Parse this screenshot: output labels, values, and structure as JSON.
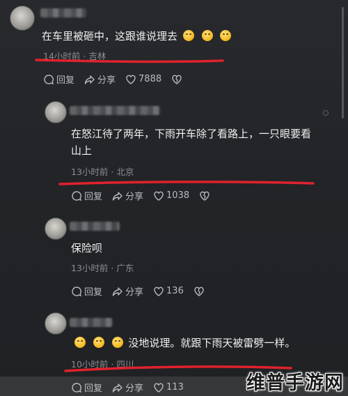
{
  "colors": {
    "accent_red": "#e0222c",
    "background": "#242629",
    "meta_text": "#8b8d92"
  },
  "comments": [
    {
      "text_parts": [
        "在车里被砸中，这跟谁说理去",
        "",
        "",
        ""
      ],
      "emoji_count": 3,
      "time": "14小时前",
      "location": "吉林",
      "reply_label": "回复",
      "share_label": "分享",
      "like_count": "7888"
    },
    {
      "text_line1": "在怒江待了两年，下雨开车除了看路上，一只眼要看",
      "text_line2": "山上",
      "time": "13小时前",
      "location": "北京",
      "reply_label": "回复",
      "share_label": "分享",
      "like_count": "1038"
    },
    {
      "text_line1": "保险呗",
      "time": "13小时前",
      "location": "广东",
      "reply_label": "回复",
      "share_label": "分享",
      "like_count": "136"
    },
    {
      "text_after_emoji": "没地说理。就跟下雨天被雷劈一样。",
      "emoji_count": 3,
      "time": "10小时前",
      "location": "四川",
      "reply_label": "回复",
      "share_label": "分享",
      "like_count": "113"
    }
  ],
  "separator": "·",
  "watermark": "维普手游网"
}
